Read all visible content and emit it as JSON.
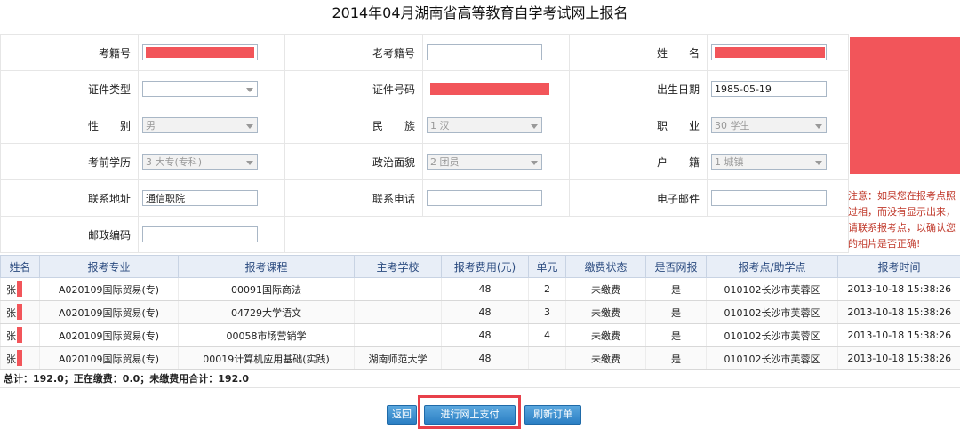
{
  "page_title": "2014年04月湖南省高等教育自学考试网上报名",
  "form": {
    "exam_no_label": "考籍号",
    "old_exam_no_label": "老考籍号",
    "name_label": "姓　　名",
    "id_type_label": "证件类型",
    "id_no_label": "证件号码",
    "birth_label": "出生日期",
    "birth_value": "1985-05-19",
    "gender_label": "性　　别",
    "gender_value": "男",
    "ethnicity_label": "民　　族",
    "ethnicity_value": "1 汉",
    "occupation_label": "职　　业",
    "occupation_value": "30 学生",
    "education_label": "考前学历",
    "education_value": "3 大专(专科)",
    "politics_label": "政治面貌",
    "politics_value": "2 团员",
    "hukou_label": "户　　籍",
    "hukou_value": "1 城镇",
    "address_label": "联系地址",
    "address_value": "通信职院",
    "phone_label": "联系电话",
    "email_label": "电子邮件",
    "postcode_label": "邮政编码"
  },
  "notice": "注意：如果您在报考点照过相，而没有显示出来，请联系报考点，以确认您的相片是否正确!",
  "grid": {
    "headers": [
      "姓名",
      "报考专业",
      "报考课程",
      "主考学校",
      "报考费用(元)",
      "单元",
      "缴费状态",
      "是否网报",
      "报考点/助学点",
      "报考时间"
    ],
    "rows": [
      {
        "name": "张",
        "major": "A020109国际贸易(专)",
        "course": "00091国际商法",
        "school": "",
        "fee": "48",
        "unit": "2",
        "status": "未缴费",
        "online": "是",
        "site": "010102长沙市芙蓉区",
        "time": "2013-10-18 15:38:26"
      },
      {
        "name": "张",
        "major": "A020109国际贸易(专)",
        "course": "04729大学语文",
        "school": "",
        "fee": "48",
        "unit": "3",
        "status": "未缴费",
        "online": "是",
        "site": "010102长沙市芙蓉区",
        "time": "2013-10-18 15:38:26"
      },
      {
        "name": "张",
        "major": "A020109国际贸易(专)",
        "course": "00058市场营销学",
        "school": "",
        "fee": "48",
        "unit": "4",
        "status": "未缴费",
        "online": "是",
        "site": "010102长沙市芙蓉区",
        "time": "2013-10-18 15:38:26"
      },
      {
        "name": "张",
        "major": "A020109国际贸易(专)",
        "course": "00019计算机应用基础(实践)",
        "school": "湖南师范大学",
        "fee": "48",
        "unit": "",
        "status": "未缴费",
        "online": "是",
        "site": "010102长沙市芙蓉区",
        "time": "2013-10-18 15:38:26"
      }
    ]
  },
  "summary": "总计：192.0；正在缴费：0.0；未缴费用合计：192.0",
  "buttons": {
    "back": "返回",
    "pay": "进行网上支付",
    "refresh": "刷新订单"
  }
}
